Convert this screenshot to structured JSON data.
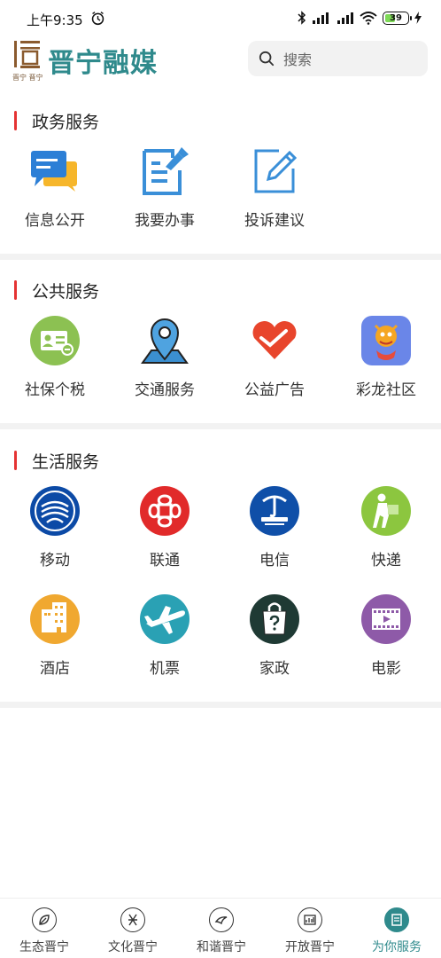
{
  "status_bar": {
    "time": "上午9:35",
    "battery": "39"
  },
  "header": {
    "logo_text": "晋宁融媒",
    "logo_sub": "晋宁 晋宁",
    "search_placeholder": "搜索"
  },
  "sections": [
    {
      "title": "政务服务",
      "items": [
        {
          "label": "信息公开",
          "icon": "chat-bubbles-icon"
        },
        {
          "label": "我要办事",
          "icon": "document-pin-icon"
        },
        {
          "label": "投诉建议",
          "icon": "edit-pencil-icon"
        }
      ]
    },
    {
      "title": "公共服务",
      "items": [
        {
          "label": "社保个税",
          "icon": "id-card-icon"
        },
        {
          "label": "交通服务",
          "icon": "map-pin-icon"
        },
        {
          "label": "公益广告",
          "icon": "heart-icon"
        },
        {
          "label": "彩龙社区",
          "icon": "dragon-icon"
        }
      ]
    },
    {
      "title": "生活服务",
      "items": [
        {
          "label": "移动",
          "icon": "china-mobile-icon"
        },
        {
          "label": "联通",
          "icon": "china-unicom-icon"
        },
        {
          "label": "电信",
          "icon": "china-telecom-icon"
        },
        {
          "label": "快递",
          "icon": "courier-icon"
        },
        {
          "label": "酒店",
          "icon": "hotel-icon"
        },
        {
          "label": "机票",
          "icon": "airplane-icon"
        },
        {
          "label": "家政",
          "icon": "housekeeping-bag-icon"
        },
        {
          "label": "电影",
          "icon": "film-icon"
        }
      ]
    }
  ],
  "bottom_nav": [
    {
      "label": "生态晋宁",
      "active": false
    },
    {
      "label": "文化晋宁",
      "active": false
    },
    {
      "label": "和谐晋宁",
      "active": false
    },
    {
      "label": "开放晋宁",
      "active": false
    },
    {
      "label": "为你服务",
      "active": true
    }
  ],
  "colors": {
    "accent": "#2f8a8c",
    "section_bar": "#e53333",
    "divider": "#f2f2f2"
  }
}
